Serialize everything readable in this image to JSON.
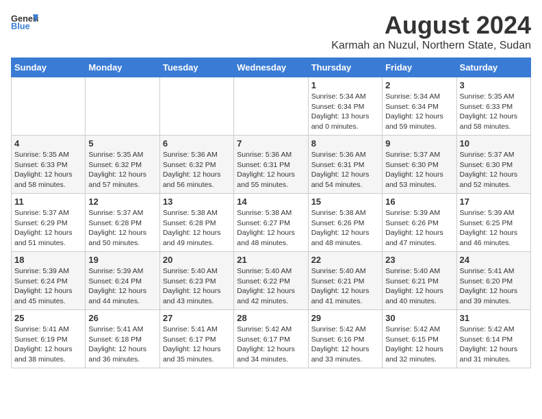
{
  "header": {
    "logo_general": "General",
    "logo_blue": "Blue",
    "month": "August 2024",
    "location": "Karmah an Nuzul, Northern State, Sudan"
  },
  "weekdays": [
    "Sunday",
    "Monday",
    "Tuesday",
    "Wednesday",
    "Thursday",
    "Friday",
    "Saturday"
  ],
  "weeks": [
    [
      {
        "day": "",
        "info": ""
      },
      {
        "day": "",
        "info": ""
      },
      {
        "day": "",
        "info": ""
      },
      {
        "day": "",
        "info": ""
      },
      {
        "day": "1",
        "info": "Sunrise: 5:34 AM\nSunset: 6:34 PM\nDaylight: 13 hours\nand 0 minutes."
      },
      {
        "day": "2",
        "info": "Sunrise: 5:34 AM\nSunset: 6:34 PM\nDaylight: 12 hours\nand 59 minutes."
      },
      {
        "day": "3",
        "info": "Sunrise: 5:35 AM\nSunset: 6:33 PM\nDaylight: 12 hours\nand 58 minutes."
      }
    ],
    [
      {
        "day": "4",
        "info": "Sunrise: 5:35 AM\nSunset: 6:33 PM\nDaylight: 12 hours\nand 58 minutes."
      },
      {
        "day": "5",
        "info": "Sunrise: 5:35 AM\nSunset: 6:32 PM\nDaylight: 12 hours\nand 57 minutes."
      },
      {
        "day": "6",
        "info": "Sunrise: 5:36 AM\nSunset: 6:32 PM\nDaylight: 12 hours\nand 56 minutes."
      },
      {
        "day": "7",
        "info": "Sunrise: 5:36 AM\nSunset: 6:31 PM\nDaylight: 12 hours\nand 55 minutes."
      },
      {
        "day": "8",
        "info": "Sunrise: 5:36 AM\nSunset: 6:31 PM\nDaylight: 12 hours\nand 54 minutes."
      },
      {
        "day": "9",
        "info": "Sunrise: 5:37 AM\nSunset: 6:30 PM\nDaylight: 12 hours\nand 53 minutes."
      },
      {
        "day": "10",
        "info": "Sunrise: 5:37 AM\nSunset: 6:30 PM\nDaylight: 12 hours\nand 52 minutes."
      }
    ],
    [
      {
        "day": "11",
        "info": "Sunrise: 5:37 AM\nSunset: 6:29 PM\nDaylight: 12 hours\nand 51 minutes."
      },
      {
        "day": "12",
        "info": "Sunrise: 5:37 AM\nSunset: 6:28 PM\nDaylight: 12 hours\nand 50 minutes."
      },
      {
        "day": "13",
        "info": "Sunrise: 5:38 AM\nSunset: 6:28 PM\nDaylight: 12 hours\nand 49 minutes."
      },
      {
        "day": "14",
        "info": "Sunrise: 5:38 AM\nSunset: 6:27 PM\nDaylight: 12 hours\nand 48 minutes."
      },
      {
        "day": "15",
        "info": "Sunrise: 5:38 AM\nSunset: 6:26 PM\nDaylight: 12 hours\nand 48 minutes."
      },
      {
        "day": "16",
        "info": "Sunrise: 5:39 AM\nSunset: 6:26 PM\nDaylight: 12 hours\nand 47 minutes."
      },
      {
        "day": "17",
        "info": "Sunrise: 5:39 AM\nSunset: 6:25 PM\nDaylight: 12 hours\nand 46 minutes."
      }
    ],
    [
      {
        "day": "18",
        "info": "Sunrise: 5:39 AM\nSunset: 6:24 PM\nDaylight: 12 hours\nand 45 minutes."
      },
      {
        "day": "19",
        "info": "Sunrise: 5:39 AM\nSunset: 6:24 PM\nDaylight: 12 hours\nand 44 minutes."
      },
      {
        "day": "20",
        "info": "Sunrise: 5:40 AM\nSunset: 6:23 PM\nDaylight: 12 hours\nand 43 minutes."
      },
      {
        "day": "21",
        "info": "Sunrise: 5:40 AM\nSunset: 6:22 PM\nDaylight: 12 hours\nand 42 minutes."
      },
      {
        "day": "22",
        "info": "Sunrise: 5:40 AM\nSunset: 6:21 PM\nDaylight: 12 hours\nand 41 minutes."
      },
      {
        "day": "23",
        "info": "Sunrise: 5:40 AM\nSunset: 6:21 PM\nDaylight: 12 hours\nand 40 minutes."
      },
      {
        "day": "24",
        "info": "Sunrise: 5:41 AM\nSunset: 6:20 PM\nDaylight: 12 hours\nand 39 minutes."
      }
    ],
    [
      {
        "day": "25",
        "info": "Sunrise: 5:41 AM\nSunset: 6:19 PM\nDaylight: 12 hours\nand 38 minutes."
      },
      {
        "day": "26",
        "info": "Sunrise: 5:41 AM\nSunset: 6:18 PM\nDaylight: 12 hours\nand 36 minutes."
      },
      {
        "day": "27",
        "info": "Sunrise: 5:41 AM\nSunset: 6:17 PM\nDaylight: 12 hours\nand 35 minutes."
      },
      {
        "day": "28",
        "info": "Sunrise: 5:42 AM\nSunset: 6:17 PM\nDaylight: 12 hours\nand 34 minutes."
      },
      {
        "day": "29",
        "info": "Sunrise: 5:42 AM\nSunset: 6:16 PM\nDaylight: 12 hours\nand 33 minutes."
      },
      {
        "day": "30",
        "info": "Sunrise: 5:42 AM\nSunset: 6:15 PM\nDaylight: 12 hours\nand 32 minutes."
      },
      {
        "day": "31",
        "info": "Sunrise: 5:42 AM\nSunset: 6:14 PM\nDaylight: 12 hours\nand 31 minutes."
      }
    ]
  ]
}
